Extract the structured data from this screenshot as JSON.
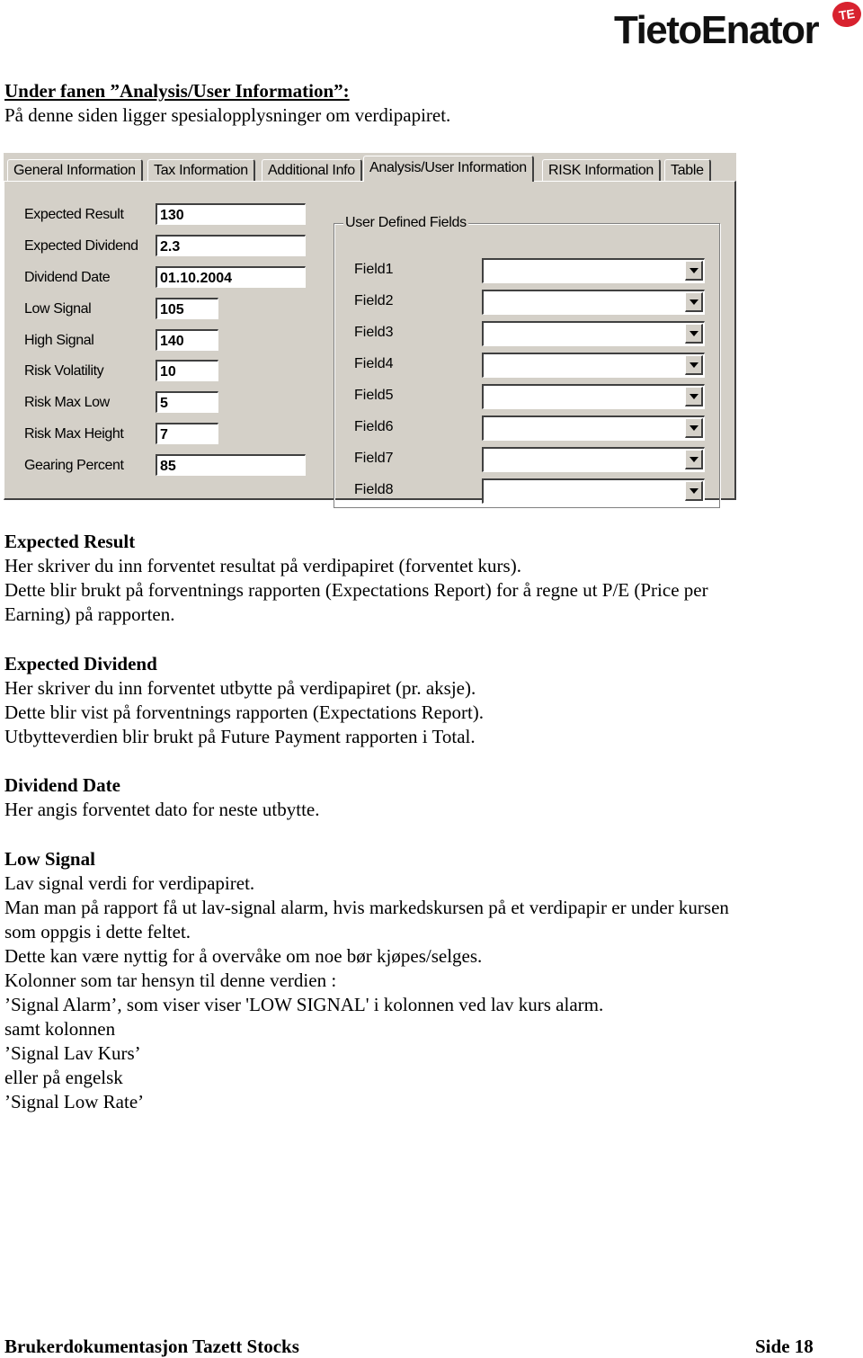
{
  "logo": {
    "name": "TietoEnator",
    "badge": "TE",
    "badge_color": "#d8222f"
  },
  "intro": {
    "heading": "Under fanen ”Analysis/User Information”:",
    "text": "På denne siden ligger spesialopplysninger om verdipapiret."
  },
  "dialog": {
    "tabs": [
      {
        "label": "General Information",
        "active": false
      },
      {
        "label": "Tax Information",
        "active": false
      },
      {
        "label": "Additional Info",
        "active": false
      },
      {
        "label": "Analysis/User Information",
        "active": true
      },
      {
        "label": "RISK Information",
        "active": false
      },
      {
        "label": "Table",
        "active": false
      }
    ],
    "fields": [
      {
        "label": "Expected Result",
        "value": "130"
      },
      {
        "label": "Expected Dividend",
        "value": "2.3"
      },
      {
        "label": "Dividend Date",
        "value": "01.10.2004"
      },
      {
        "label": "Low Signal",
        "value": "105"
      },
      {
        "label": "High Signal",
        "value": "140"
      },
      {
        "label": "Risk Volatility",
        "value": "10"
      },
      {
        "label": "Risk Max Low",
        "value": "5"
      },
      {
        "label": "Risk Max Height",
        "value": "7"
      },
      {
        "label": "Gearing Percent",
        "value": "85"
      }
    ],
    "user_defined": {
      "title": "User Defined Fields",
      "fields": [
        {
          "label": "Field1",
          "value": ""
        },
        {
          "label": "Field2",
          "value": ""
        },
        {
          "label": "Field3",
          "value": ""
        },
        {
          "label": "Field4",
          "value": ""
        },
        {
          "label": "Field5",
          "value": ""
        },
        {
          "label": "Field6",
          "value": ""
        },
        {
          "label": "Field7",
          "value": ""
        },
        {
          "label": "Field8",
          "value": ""
        }
      ]
    }
  },
  "sections": [
    {
      "heading": "Expected Result",
      "lines": [
        "Her skriver du inn forventet resultat på verdipapiret (forventet kurs).",
        "Dette blir brukt på forventnings rapporten (Expectations Report) for å regne ut P/E (Price per",
        "Earning) på rapporten."
      ]
    },
    {
      "heading": "Expected Dividend",
      "lines": [
        "Her skriver du inn forventet utbytte på verdipapiret (pr. aksje).",
        "Dette blir vist på forventnings rapporten (Expectations Report).",
        "Utbytteverdien blir brukt på Future Payment rapporten i Total."
      ]
    },
    {
      "heading": "Dividend Date",
      "lines": [
        "Her angis forventet dato for neste utbytte."
      ]
    },
    {
      "heading": "Low Signal",
      "lines": [
        "Lav signal verdi for verdipapiret.",
        "Man man på rapport få ut lav-signal alarm, hvis markedskursen på et verdipapir er under kursen",
        "som oppgis i dette feltet.",
        "Dette kan være nyttig for å overvåke om noe bør kjøpes/selges.",
        "Kolonner som tar hensyn til denne verdien :",
        "’Signal Alarm’, som viser viser 'LOW SIGNAL' i kolonnen ved lav kurs alarm.",
        "samt kolonnen",
        "’Signal Lav Kurs’",
        "eller på engelsk",
        "’Signal Low Rate’"
      ]
    }
  ],
  "footer": {
    "left": "Brukerdokumentasjon Tazett Stocks",
    "right": "Side 18"
  }
}
